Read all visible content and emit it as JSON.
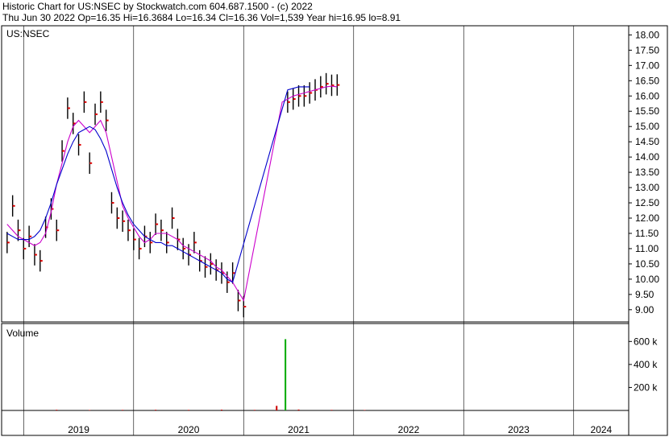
{
  "header": {
    "line1": "Historic Chart for US:NSEC by Stockwatch.com 604.687.1500 - (c) 2022",
    "line2": "Thu Jun 30 2022   Op=16.35   Hi=16.3684   Lo=16.34   Cl=16.36   Vol=1,539   Year hi=16.95   lo=8.91"
  },
  "colors": {
    "ohlc": "#000000",
    "close_tick": "#dd0000",
    "ma_short": "#cc00cc",
    "ma_long": "#0000cc",
    "vol_up": "#00aa00",
    "vol_down": "#cc0000",
    "grid": "#000000"
  },
  "chart_data": [
    {
      "type": "line",
      "title": "US:NSEC",
      "ylim": [
        8.6,
        18.3
      ],
      "yticks": [
        "18.00",
        "17.50",
        "17.00",
        "16.50",
        "16.00",
        "15.50",
        "15.00",
        "14.50",
        "14.00",
        "13.50",
        "13.00",
        "12.50",
        "12.00",
        "11.50",
        "11.00",
        "10.50",
        "10.00",
        "9.50",
        "9.00"
      ],
      "x": [
        2018.85,
        2018.9,
        2018.95,
        2019.0,
        2019.05,
        2019.1,
        2019.15,
        2019.2,
        2019.25,
        2019.3,
        2019.35,
        2019.4,
        2019.45,
        2019.5,
        2019.55,
        2019.6,
        2019.65,
        2019.7,
        2019.75,
        2019.8,
        2019.85,
        2019.9,
        2019.95,
        2020.0,
        2020.05,
        2020.1,
        2020.15,
        2020.2,
        2020.25,
        2020.3,
        2020.35,
        2020.4,
        2020.45,
        2020.5,
        2020.55,
        2020.6,
        2020.65,
        2020.7,
        2020.75,
        2020.8,
        2020.85,
        2020.9,
        2020.95,
        2021.0,
        2021.05,
        2021.1,
        2021.15,
        2021.2,
        2021.25,
        2021.3,
        2021.35,
        2021.4,
        2021.45,
        2021.5,
        2021.55,
        2021.6,
        2021.65,
        2021.7,
        2021.75,
        2021.8,
        2021.85,
        2021.9,
        2021.95,
        2022.0,
        2022.05,
        2022.1,
        2022.15,
        2022.2,
        2022.25,
        2022.3,
        2022.35,
        2022.4,
        2022.45,
        2022.5
      ],
      "series": [
        {
          "name": "",
          "values": [
            11.2,
            12.4,
            11.6,
            11.0,
            11.4,
            10.8,
            10.6,
            11.7,
            12.3,
            11.6,
            14.2,
            15.6,
            15.1,
            14.4,
            15.8,
            13.8,
            15.4,
            15.8,
            15.2,
            12.5,
            12.0,
            11.9,
            11.6,
            11.3,
            11.0,
            11.4,
            11.2,
            11.8,
            11.6,
            11.2,
            12.0,
            11.3,
            11.0,
            10.8,
            11.2,
            10.6,
            10.4,
            10.5,
            10.3,
            10.2,
            9.9,
            10.2,
            9.3,
            9.1,
            null,
            null,
            null,
            null,
            null,
            null,
            null,
            15.8,
            15.9,
            16.0,
            16.0,
            16.1,
            16.2,
            16.3,
            16.4,
            16.35,
            16.36,
            null,
            null,
            null,
            null,
            null,
            null,
            null,
            null,
            null,
            null,
            null,
            null,
            null
          ]
        },
        {
          "name": "",
          "values": [
            11.8,
            11.6,
            11.4,
            11.3,
            11.2,
            11.1,
            11.2,
            11.5,
            12.2,
            13.1,
            13.8,
            14.5,
            15.0,
            15.2,
            15.0,
            14.8,
            15.0,
            15.2,
            14.8,
            14.0,
            13.2,
            12.4,
            12.0,
            11.7,
            11.4,
            11.2,
            11.3,
            11.5,
            11.5,
            11.5,
            11.4,
            11.3,
            11.1,
            11.0,
            10.9,
            10.8,
            10.7,
            10.6,
            10.4,
            10.3,
            10.1,
            9.9,
            9.6,
            9.3,
            null,
            null,
            null,
            null,
            null,
            null,
            15.8,
            15.9,
            16.0,
            16.05,
            16.1,
            16.15,
            16.2,
            16.25,
            16.3,
            16.32,
            16.3,
            null,
            null,
            null,
            null,
            null,
            null,
            null,
            null,
            null,
            null,
            null,
            null,
            null
          ]
        },
        {
          "name": "",
          "values": [
            11.5,
            11.4,
            11.3,
            11.3,
            11.3,
            11.4,
            11.6,
            12.0,
            12.5,
            13.1,
            13.6,
            14.1,
            14.5,
            14.8,
            14.9,
            15.0,
            14.9,
            14.6,
            14.2,
            13.6,
            13.0,
            12.5,
            12.1,
            11.8,
            11.6,
            11.4,
            11.3,
            11.2,
            11.2,
            11.1,
            11.1,
            11.0,
            10.9,
            10.8,
            10.7,
            10.6,
            10.5,
            10.4,
            10.3,
            10.2,
            10.0,
            9.9,
            null,
            null,
            null,
            null,
            null,
            null,
            null,
            null,
            null,
            16.2,
            16.25,
            16.3,
            16.3,
            16.3,
            null,
            null,
            null,
            null,
            null,
            null,
            null,
            null,
            null,
            null,
            null,
            null,
            null,
            null,
            null,
            null,
            null,
            null
          ]
        }
      ]
    },
    {
      "type": "bar",
      "title": "Volume",
      "yticks": [
        "600 k",
        "400 k",
        "200 k"
      ],
      "ylim": [
        0,
        700
      ],
      "x": [
        2019.3,
        2019.6,
        2019.9,
        2020.2,
        2020.5,
        2020.8,
        2021.1,
        2021.3,
        2021.38,
        2021.5,
        2021.8,
        2022.1
      ],
      "values": [
        6,
        4,
        5,
        6,
        5,
        7,
        5,
        40,
        620,
        8,
        5,
        4
      ]
    },
    {
      "type": "bar",
      "title": "",
      "categories": [
        "2019",
        "2020",
        "2021",
        "2022",
        "2023",
        "2024"
      ]
    }
  ]
}
